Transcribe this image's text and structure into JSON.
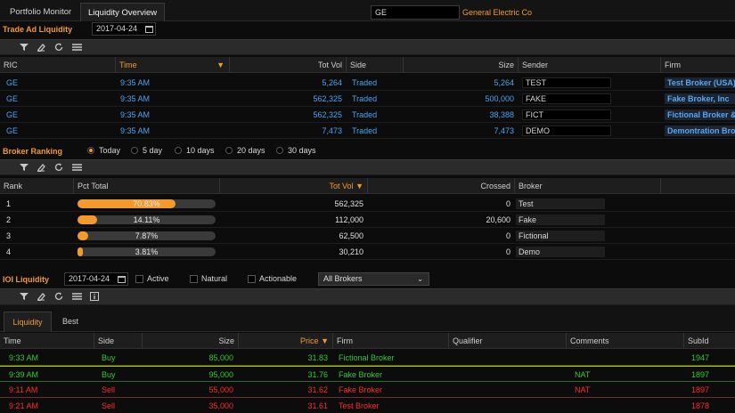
{
  "tabs": [
    {
      "label": "Portfolio Monitor"
    },
    {
      "label": "Liquidity Overview"
    }
  ],
  "symbol": {
    "value": "GE",
    "company": "General Electric Co"
  },
  "trade_ad": {
    "title": "Trade Ad Liquidity",
    "date": "2017-04-24",
    "columns": [
      "RIC",
      "Time",
      "Tot Vol",
      "Side",
      "Size",
      "Sender",
      "Firm"
    ],
    "rows": [
      {
        "ric": "GE",
        "time": "9:35 AM",
        "tot_vol": "5,264",
        "side": "Traded",
        "size": "5,264",
        "sender": "TEST",
        "firm": "Test Broker (USA)"
      },
      {
        "ric": "GE",
        "time": "9:35 AM",
        "tot_vol": "562,325",
        "side": "Traded",
        "size": "500,000",
        "sender": "FAKE",
        "firm": "Fake Broker, Inc"
      },
      {
        "ric": "GE",
        "time": "9:35 AM",
        "tot_vol": "562,325",
        "side": "Traded",
        "size": "38,388",
        "sender": "FICT",
        "firm": "Fictional Broker & Co"
      },
      {
        "ric": "GE",
        "time": "9:35 AM",
        "tot_vol": "7,473",
        "side": "Traded",
        "size": "7,473",
        "sender": "DEMO",
        "firm": "Demontration Broker"
      }
    ]
  },
  "broker_ranking": {
    "title": "Broker Ranking",
    "periods": [
      {
        "label": "Today",
        "selected": true
      },
      {
        "label": "5 day",
        "selected": false
      },
      {
        "label": "10 days",
        "selected": false
      },
      {
        "label": "20 days",
        "selected": false
      },
      {
        "label": "30 days",
        "selected": false
      }
    ],
    "columns": [
      "Rank",
      "Pct Total",
      "Tot Vol",
      "Crossed",
      "Broker"
    ],
    "rows": [
      {
        "rank": "1",
        "pct": "70.83%",
        "pct_value": 0.7083,
        "tot_vol": "562,325",
        "crossed": "0",
        "broker": "Test"
      },
      {
        "rank": "2",
        "pct": "14.11%",
        "pct_value": 0.1411,
        "tot_vol": "112,000",
        "crossed": "20,600",
        "broker": "Fake"
      },
      {
        "rank": "3",
        "pct": "7.87%",
        "pct_value": 0.0787,
        "tot_vol": "62,500",
        "crossed": "0",
        "broker": "Fictional"
      },
      {
        "rank": "4",
        "pct": "3.81%",
        "pct_value": 0.0381,
        "tot_vol": "30,210",
        "crossed": "0",
        "broker": "Demo"
      }
    ]
  },
  "ioi": {
    "title": "IOI Liquidity",
    "date": "2017-04-24",
    "filters": [
      {
        "label": "Active",
        "checked": false
      },
      {
        "label": "Natural",
        "checked": false
      },
      {
        "label": "Actionable",
        "checked": false
      }
    ],
    "broker_select": "All Brokers",
    "subtabs": [
      {
        "label": "Liquidity"
      },
      {
        "label": "Best"
      }
    ],
    "columns": [
      "Time",
      "Side",
      "Size",
      "Price",
      "Firm",
      "Qualifier",
      "Comments",
      "SubId"
    ],
    "rows": [
      {
        "time": "9:33 AM",
        "side": "Buy",
        "size": "85,000",
        "price": "31.83",
        "firm": "Fictional Broker",
        "qualifier": "",
        "comments": "",
        "subid": "1947",
        "color": "green"
      },
      {
        "time": "9:39 AM",
        "side": "Buy",
        "size": "95,000",
        "price": "31.76",
        "firm": "Fake Broker",
        "qualifier": "",
        "comments": "NAT",
        "subid": "1897",
        "color": "green"
      },
      {
        "time": "9:11 AM",
        "side": "Sell",
        "size": "55,000",
        "price": "31.62",
        "firm": "Fake Broker",
        "qualifier": "",
        "comments": "NAT",
        "subid": "1897",
        "color": "red"
      },
      {
        "time": "9:21 AM",
        "side": "Sell",
        "size": "35,000",
        "price": "31.61",
        "firm": "Test Broker",
        "qualifier": "",
        "comments": "",
        "subid": "1878",
        "color": "red"
      }
    ]
  },
  "icons": [
    "filter-icon",
    "eraser-icon",
    "refresh-icon",
    "menu-icon",
    "calendar-icon",
    "info-icon",
    "sort-desc-icon",
    "chevron-down-icon"
  ]
}
